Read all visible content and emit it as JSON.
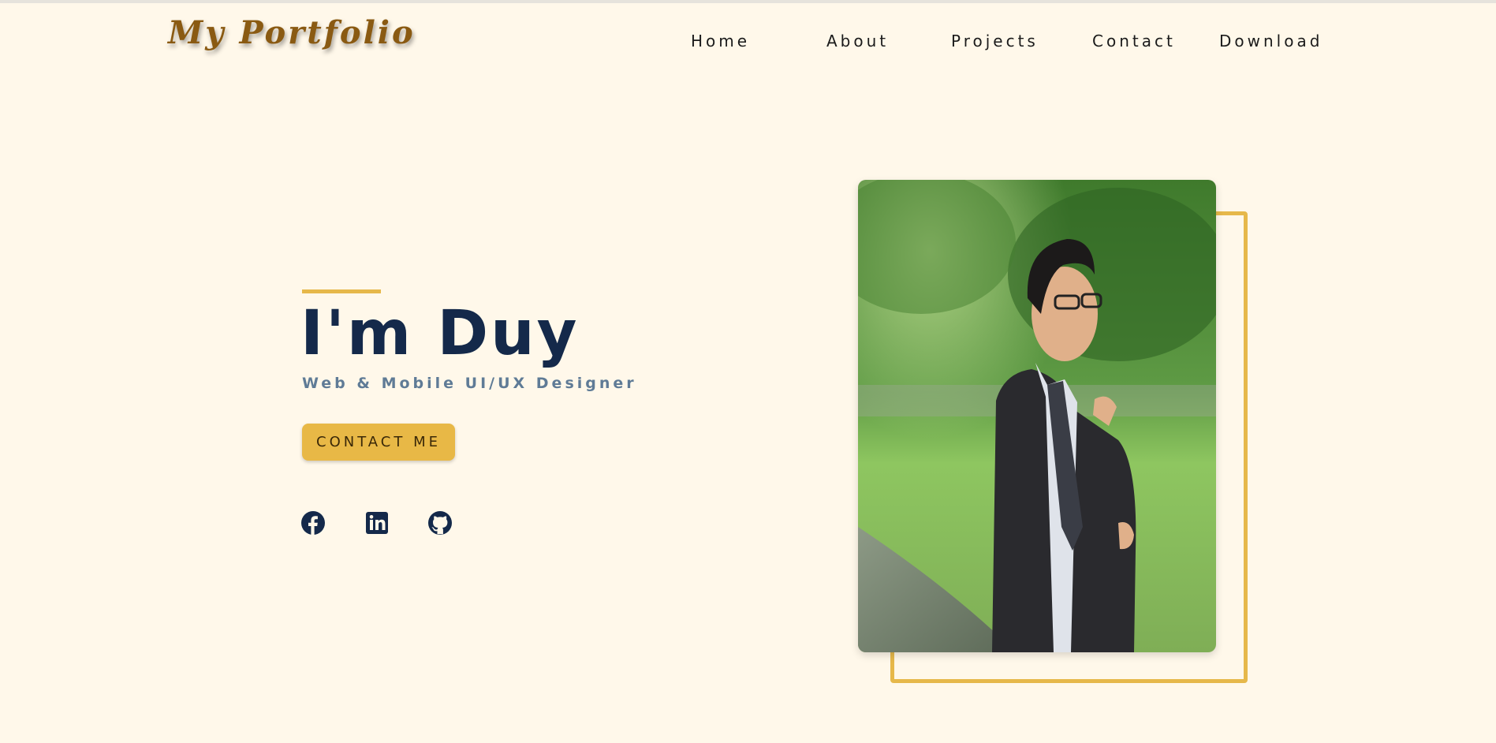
{
  "brand": {
    "logo_text": "My Portfolio"
  },
  "nav": {
    "items": [
      {
        "label": "Home"
      },
      {
        "label": "About"
      },
      {
        "label": "Projects"
      },
      {
        "label": "Contact"
      },
      {
        "label": "Download"
      }
    ]
  },
  "hero": {
    "title": "I'm Duy",
    "subtitle": "Web & Mobile UI/UX Designer",
    "cta_label": "CONTACT ME",
    "socials": [
      {
        "icon": "facebook-icon"
      },
      {
        "icon": "linkedin-icon"
      },
      {
        "icon": "github-icon"
      }
    ],
    "photo_icon": "portrait-photo"
  },
  "colors": {
    "background": "#fff8ea",
    "accent": "#e6b84a",
    "heading": "#14294a",
    "subtitle": "#5f7b96",
    "logo": "#8a5a12"
  }
}
